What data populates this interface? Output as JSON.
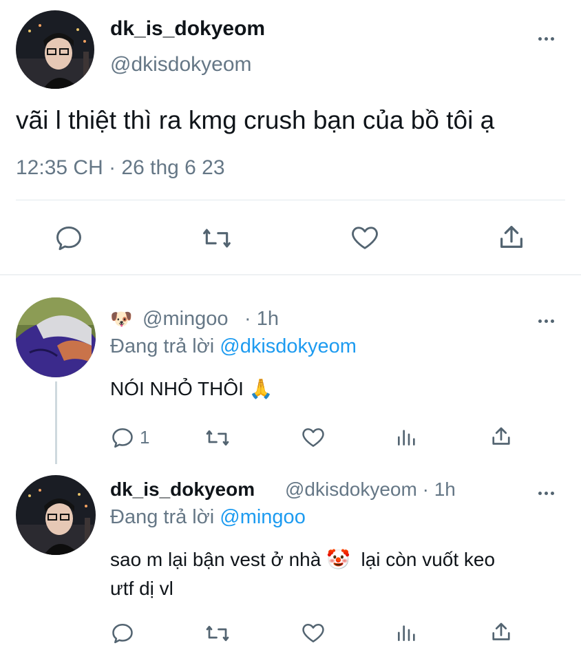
{
  "main_tweet": {
    "display_name": "dk_is_dokyeom",
    "handle": "@dkisdokyeom",
    "text": "vãi l thiệt thì ra kmg crush bạn của bồ tôi ạ",
    "time": "12:35 CH · 26 thg 6 23"
  },
  "reply1": {
    "emoji": "🐶",
    "handle": "@mingoo",
    "time_ago": "· 1h",
    "replying_prefix": "Đang trả lời",
    "replying_to": "@dkisdokyeom",
    "text": "NÓI NHỎ THÔI 🙏",
    "reply_count": "1"
  },
  "reply2": {
    "display_name": "dk_is_dokyeom",
    "handle_time": "@dkisdokyeom · 1h",
    "replying_prefix": "Đang trả lời",
    "replying_to": "@mingoo",
    "text_line1": "sao m lại bận vest ở nhà 🤡  lại còn vuốt keo",
    "text_line2": "ưtf dị vl"
  },
  "colors": {
    "text": "#0f1419",
    "secondary": "#657786",
    "accent": "#1d9bf0",
    "divider": "#e1e8ed"
  },
  "icons": [
    "reply-icon",
    "retweet-icon",
    "like-icon",
    "share-icon",
    "analytics-icon",
    "more-icon"
  ]
}
